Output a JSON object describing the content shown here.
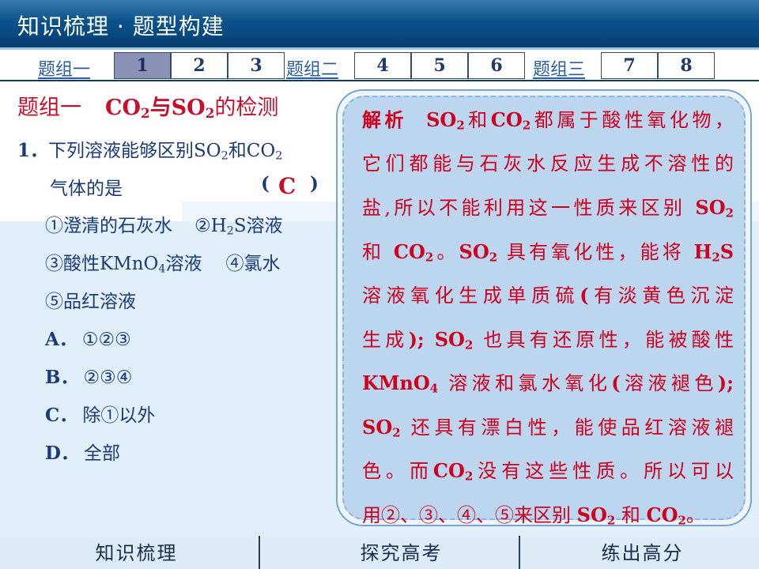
{
  "header": {
    "title": "知识梳理 · 题型构建"
  },
  "tabs": {
    "groups": [
      {
        "label": "题组一",
        "buttons": [
          "1",
          "2",
          "3"
        ]
      },
      {
        "label": "题组二",
        "buttons": [
          "4",
          "5",
          "6"
        ]
      },
      {
        "label": "题组三",
        "buttons": [
          "7",
          "8"
        ]
      }
    ],
    "active": "1"
  },
  "question": {
    "group_title": "题组一",
    "topic_pre": "CO",
    "topic_sub1": "2",
    "topic_mid": "与SO",
    "topic_sub2": "2",
    "topic_post": "的检测",
    "number": "1．",
    "stem_line1_pre": "下列溶液能够区别SO",
    "stem_line1_sub1": "2",
    "stem_line1_mid": "和CO",
    "stem_line1_sub2": "2",
    "stem_line2": "气体的是",
    "paren_open": "(",
    "paren_close": ")",
    "answer": "C",
    "item1": "①澄清的石灰水",
    "item2_pre": "②H",
    "item2_sub": "2",
    "item2_post": "S溶液",
    "item3_pre": "③酸性KMnO",
    "item3_sub": "4",
    "item3_post": "溶液",
    "item4": "④氯水",
    "item5": "⑤品红溶液",
    "options": [
      {
        "letter": "A．",
        "text": "①②③"
      },
      {
        "letter": "B．",
        "text": "②③④"
      },
      {
        "letter": "C．",
        "text": "除①以外"
      },
      {
        "letter": "D．",
        "text": "全部"
      }
    ]
  },
  "explanation": {
    "label": "解析",
    "l1_a": "SO",
    "l1_a_sub": "2",
    "l1_b": "和",
    "l1_c": "CO",
    "l1_c_sub": "2",
    "l1_d": "都属于酸性氧化物，",
    "l2": "它们都能与石灰水反应生成不溶性的",
    "l3_a": "盐,所以不能利用这一性质来区别",
    "l3_b": "SO",
    "l3_b_sub": "2",
    "l4_a": "和",
    "l4_b": "CO",
    "l4_b_sub": "2",
    "l4_c": "。",
    "l4_d": "SO",
    "l4_d_sub": "2",
    "l4_e": "具有氧化性，能将",
    "l4_f": "H",
    "l4_f_sub": "2",
    "l4_g": "S",
    "l5_a": "溶液氧化生成单质硫",
    "l5_b": "(",
    "l5_c": "有淡黄色沉淀",
    "l6_a": "生成",
    "l6_b": ");",
    "l6_c": "SO",
    "l6_c_sub": "2",
    "l6_d": "也具有还原性，能被酸性",
    "l7_a": "KMnO",
    "l7_a_sub": "4",
    "l7_b": "溶液和氯水氧化",
    "l7_c": "(",
    "l7_d": "溶液褪色",
    "l7_e": ");",
    "l8_a": "SO",
    "l8_a_sub": "2",
    "l8_b": "还具有漂白性，能使品红溶液褪",
    "l9_a": "色。而",
    "l9_b": "CO",
    "l9_b_sub": "2",
    "l9_c": "没有这些性质。所以可以",
    "l10_a": "用②、③、④、⑤来区别",
    "l10_b": "SO",
    "l10_b_sub": "2",
    "l10_c": "和",
    "l10_d": "CO",
    "l10_d_sub": "2",
    "l10_e": "。"
  },
  "footer": {
    "nav": [
      "知识梳理",
      "探究高考",
      "练出高分"
    ]
  },
  "colors": {
    "title_bar": "#0a4f88",
    "question_red": "#c8102e",
    "body_blue": "#1b3b78",
    "card_fill": "#bcd6ef",
    "active_tab": "#8a92b8"
  }
}
